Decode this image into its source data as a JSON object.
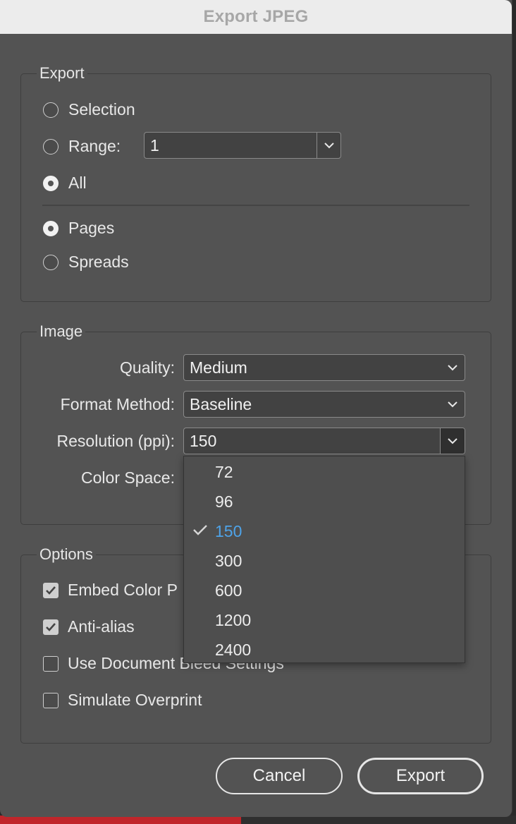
{
  "window": {
    "title": "Export JPEG"
  },
  "export": {
    "legend": "Export",
    "selection": "Selection",
    "range": "Range:",
    "range_value": "1",
    "all": "All",
    "pages": "Pages",
    "spreads": "Spreads",
    "selected_scope": "All",
    "selected_layout": "Pages"
  },
  "image": {
    "legend": "Image",
    "quality_label": "Quality:",
    "quality_value": "Medium",
    "format_label": "Format Method:",
    "format_value": "Baseline",
    "resolution_label": "Resolution (ppi):",
    "resolution_value": "150",
    "colorspace_label": "Color Space:"
  },
  "resolution_menu": {
    "options": [
      "72",
      "96",
      "150",
      "300",
      "600",
      "1200",
      "2400"
    ],
    "selected": "150"
  },
  "options": {
    "legend": "Options",
    "embed": "Embed Color P",
    "antialias": "Anti-alias",
    "bleed": "Use Document Bleed Settings",
    "overprint": "Simulate Overprint",
    "embed_checked": true,
    "antialias_checked": true,
    "bleed_checked": false,
    "overprint_checked": false
  },
  "buttons": {
    "cancel": "Cancel",
    "export": "Export"
  },
  "colors": {
    "accent": "#4ea3e8",
    "panel": "#535353",
    "titlebar": "#ececec"
  }
}
